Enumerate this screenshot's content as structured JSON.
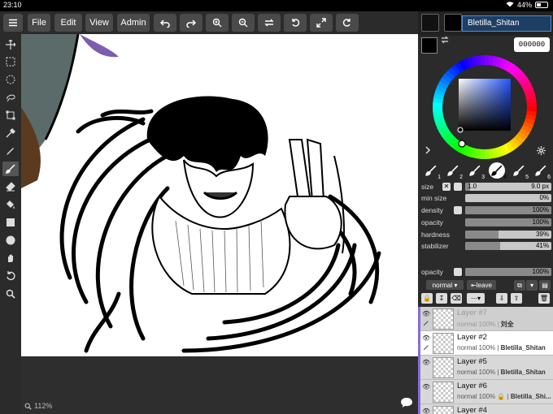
{
  "status_bar": {
    "time": "23:10",
    "battery": "44%",
    "battery_level": 0.44
  },
  "toolbar": {
    "menu_file": "File",
    "menu_edit": "Edit",
    "menu_view": "View",
    "menu_admin": "Admin"
  },
  "tools": [
    "move-icon",
    "rect-select-icon",
    "ellipse-select-icon",
    "lasso-icon",
    "transform-icon",
    "eyedropper-icon",
    "pen-icon",
    "brush-icon",
    "eraser-icon",
    "fill-icon",
    "rectangle-icon",
    "circle-icon",
    "hand-icon",
    "rotate-icon",
    "zoom-icon"
  ],
  "canvas": {
    "zoom": "112%"
  },
  "user": {
    "name": "Bletilla_Shitan",
    "avatar_text": "..."
  },
  "color": {
    "hex": "000000",
    "primary": "#000000",
    "secondary": "#ffffff"
  },
  "brush_presets": [
    "1",
    "2",
    "3",
    "4",
    "5",
    "6"
  ],
  "brush": {
    "size_label": "size",
    "size_min": "1.0",
    "size_value": "9.0 px",
    "min_size_label": "min size",
    "min_size_value": "0%",
    "density_label": "density",
    "density_value": "100%",
    "opacity_label": "opacity",
    "opacity_value": "100%",
    "hardness_label": "hardness",
    "hardness_value": "39%",
    "stabilizer_label": "stabilizer",
    "stabilizer_value": "41%"
  },
  "layer_panel": {
    "opacity_label": "opacity",
    "opacity_value": "100%",
    "blend_mode": "normal",
    "leave_label": "leave"
  },
  "layers": [
    {
      "name": "Layer #7",
      "meta": "normal 100%",
      "owner": "刘全"
    },
    {
      "name": "Layer #2",
      "meta": "normal 100%",
      "owner": "Bletilla_Shitan"
    },
    {
      "name": "Layer #5",
      "meta": "normal 100%",
      "owner": "Bletilla_Shitan"
    },
    {
      "name": "Layer #6",
      "meta": "normal 100% 🔒",
      "owner": "Bletilla_Shi..."
    },
    {
      "name": "Layer #4",
      "meta": "",
      "owner": ""
    }
  ]
}
